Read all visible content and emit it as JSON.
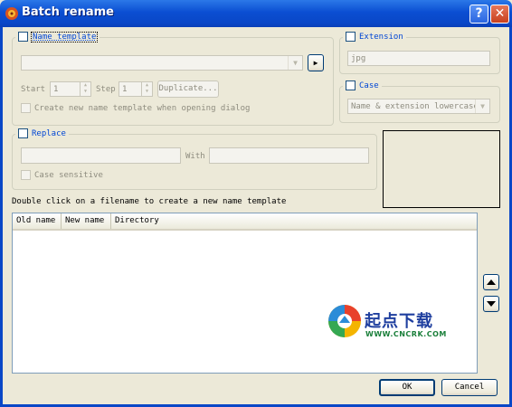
{
  "window": {
    "title": "Batch rename"
  },
  "name_template": {
    "label": "Name template",
    "start_label": "Start",
    "start_value": "1",
    "step_label": "Step",
    "step_value": "1",
    "duplicate_label": "Duplicate...",
    "create_new_label": "Create new name template when opening dialog"
  },
  "extension": {
    "label": "Extension",
    "value": "jpg"
  },
  "case": {
    "label": "Case",
    "selected": "Name & extension lowercase"
  },
  "replace": {
    "label": "Replace",
    "with_label": "With",
    "case_sensitive_label": "Case sensitive"
  },
  "hint": "Double click on a filename to create a new name template",
  "list": {
    "columns": [
      "Old name",
      "New name",
      "Directory"
    ]
  },
  "buttons": {
    "ok": "OK",
    "cancel": "Cancel"
  },
  "watermark": {
    "text": "起点下载",
    "sub": "WWW.CNCRK.COM"
  },
  "colors": {
    "title_bar": "#0a47c7",
    "legend_text": "#0046d5",
    "disabled_text": "#8e8c7f"
  }
}
